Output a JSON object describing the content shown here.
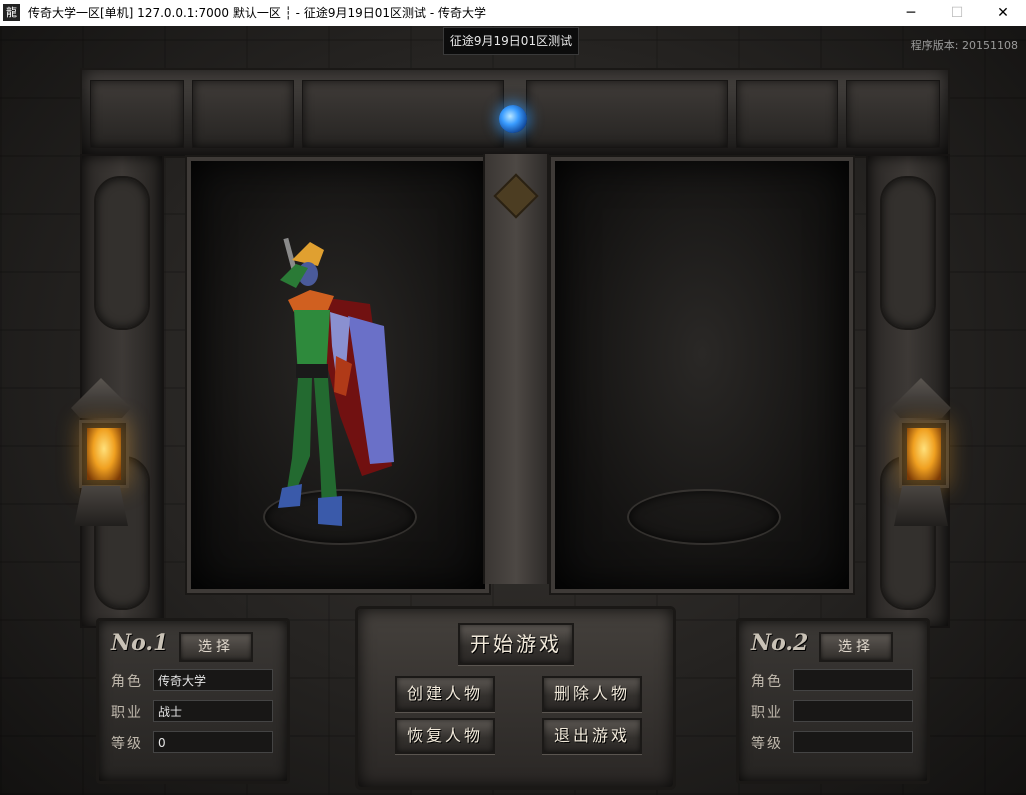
{
  "window": {
    "title": "传奇大学一区[单机] 127.0.0.1:7000   默认一区 ┆ - 征途9月19日01区测试 - 传奇大学",
    "icon_glyph": "龍",
    "minimize_glyph": "─",
    "maximize_glyph": "☐",
    "close_glyph": "✕"
  },
  "header": {
    "server_name": "征途9月19日01区测试",
    "version": "程序版本: 20151108"
  },
  "slots": [
    {
      "label": "No.1",
      "select_label": "选择",
      "fields": [
        {
          "label": "角色",
          "value": "传奇大学"
        },
        {
          "label": "职业",
          "value": "战士"
        },
        {
          "label": "等级",
          "value": "0"
        }
      ]
    },
    {
      "label": "No.2",
      "select_label": "选择",
      "fields": [
        {
          "label": "角色",
          "value": ""
        },
        {
          "label": "职业",
          "value": ""
        },
        {
          "label": "等级",
          "value": ""
        }
      ]
    }
  ],
  "menu": {
    "start": "开始游戏",
    "create": "创建人物",
    "delete": "删除人物",
    "restore": "恢复人物",
    "exit": "退出游戏"
  },
  "colors": {
    "orb": "#3a9cff",
    "lantern_light": "#f0a020",
    "button_text": "#f1e9da"
  }
}
